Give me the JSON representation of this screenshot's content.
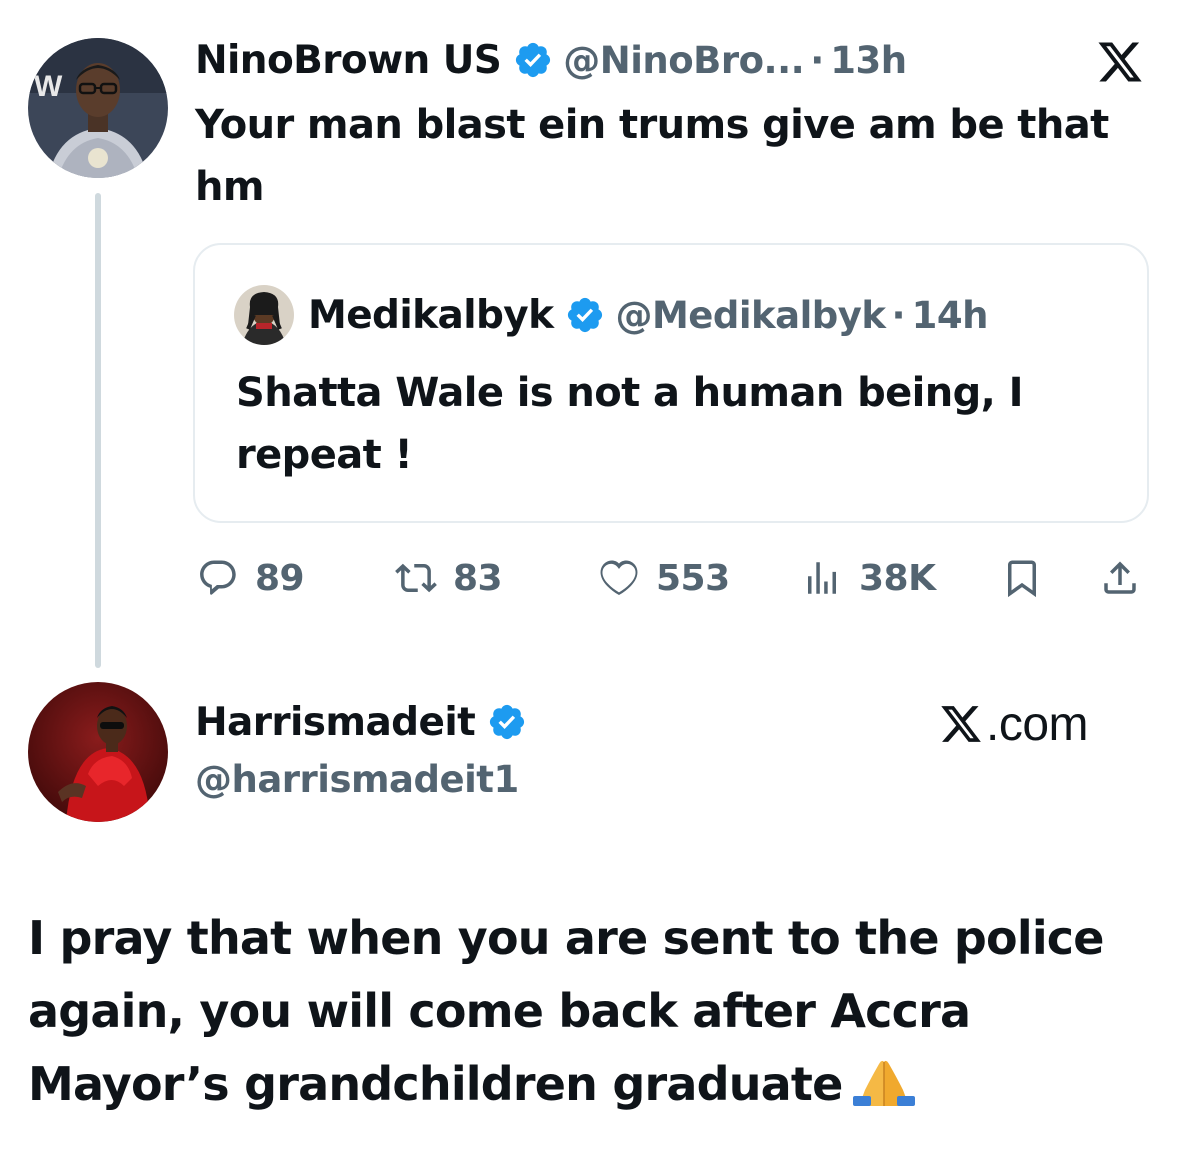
{
  "tweet": {
    "author": {
      "name": "NinoBrown US",
      "handle": "@NinoBro...",
      "time": "13h",
      "verified": true
    },
    "text": "Your man blast ein trums give am be that hm",
    "quoted": {
      "author": {
        "name": "Medikalbyk",
        "handle": "@Medikalbyk",
        "time": "14h",
        "verified": true
      },
      "text": "Shatta Wale is not a human being, I repeat !"
    },
    "actions": {
      "replies": "89",
      "reposts": "83",
      "likes": "553",
      "views": "38K"
    },
    "separator": "·"
  },
  "reply": {
    "author": {
      "name": "Harrismadeit",
      "handle": "@harrismadeit1",
      "verified": true
    },
    "watermark": ".com",
    "text": "I pray that when you are sent to the police again, you will come back after Accra Mayor’s grandchildren graduate"
  },
  "colors": {
    "text": "#0f1419",
    "secondary": "#536471",
    "verified_blue": "#1d9bf0",
    "border": "#e6ecf0",
    "thread_line": "#cfd9de"
  },
  "icons": [
    "x-logo-icon",
    "verified-badge-icon",
    "reply-icon",
    "repost-icon",
    "like-icon",
    "views-icon",
    "bookmark-icon",
    "share-icon",
    "folded-hands-emoji"
  ]
}
